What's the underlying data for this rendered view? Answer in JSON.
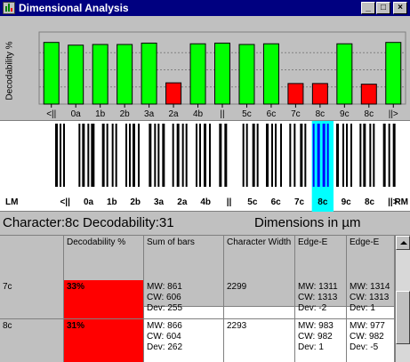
{
  "window": {
    "title": "Dimensional Analysis",
    "minimize": "_",
    "maximize": "□",
    "close": "×"
  },
  "chart": {
    "ylabel": "Decodability %",
    "bar_colors": {
      "good": "#00ff00",
      "bad": "#ff0000"
    }
  },
  "chart_data": {
    "type": "bar",
    "categories": [
      "<||",
      "0a",
      "1b",
      "2b",
      "3a",
      "2a",
      "4b",
      "||",
      "5c",
      "6c",
      "7c",
      "8c",
      "9c",
      "8c",
      "||>"
    ],
    "values": [
      90,
      86,
      87,
      87,
      89,
      31,
      88,
      89,
      87,
      88,
      30,
      30,
      88,
      29,
      90
    ],
    "status": [
      "good",
      "good",
      "good",
      "good",
      "good",
      "bad",
      "good",
      "good",
      "good",
      "good",
      "bad",
      "bad",
      "good",
      "bad",
      "good"
    ],
    "ylabel": "Decodability %",
    "ylim": [
      0,
      100
    ],
    "grid": true
  },
  "barcode": {
    "left_label": "LM",
    "right_label": "RM",
    "labels": [
      "<||",
      "0a",
      "1b",
      "2b",
      "3a",
      "2a",
      "4b",
      "||",
      "5c",
      "6c",
      "7c",
      "8c",
      "9c",
      "8c",
      "||>"
    ],
    "selected_index": 11,
    "highlight_color": "#00ffff",
    "selected_bar_color": "#0000ff"
  },
  "info": {
    "character_label": "Character:8c Decodability:31",
    "dimensions_label": "Dimensions in µm"
  },
  "grid": {
    "columns": [
      "Decodability %",
      "Sum of bars",
      "Character Width",
      "Edge-E",
      "Edge-E"
    ],
    "rows": [
      {
        "header": "7c",
        "decodability": "33%",
        "sum_of_bars": [
          "MW: 861",
          "CW: 606",
          "Dev: 255"
        ],
        "char_width": "2299",
        "edge_e1": [
          "MW: 1311",
          "CW: 1313",
          "Dev: -2"
        ],
        "edge_e2": [
          "MW: 1314",
          "CW: 1313",
          "Dev: 1"
        ]
      },
      {
        "header": "8c",
        "decodability": "31%",
        "sum_of_bars": [
          "MW: 866",
          "CW: 604",
          "Dev: 262"
        ],
        "char_width": "2293",
        "edge_e1": [
          "MW: 983",
          "CW: 982",
          "Dev: 1"
        ],
        "edge_e2": [
          "MW: 977",
          "CW: 982",
          "Dev: -5"
        ]
      }
    ]
  }
}
